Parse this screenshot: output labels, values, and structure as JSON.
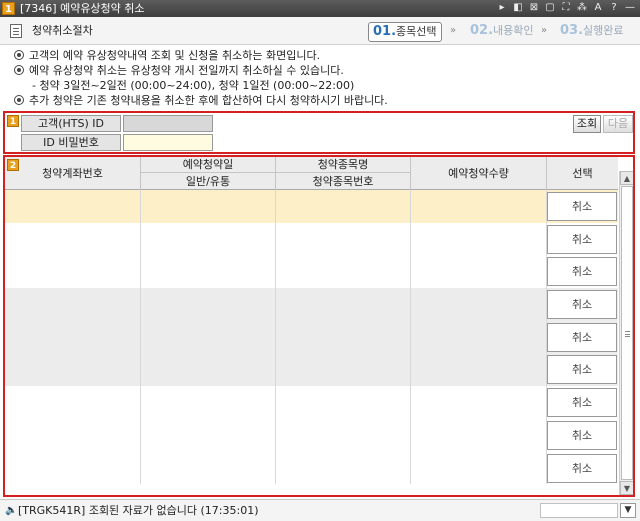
{
  "window": {
    "badge": "1",
    "title": "[7346] 예약유상청약 취소",
    "controls": [
      "▸",
      "◧",
      "⊠",
      "▢",
      "⛶",
      "⁂",
      "A",
      "?",
      "—"
    ]
  },
  "header": {
    "section_title": "청약취소절차",
    "steps": [
      {
        "num": "01.",
        "label": "종목선택"
      },
      {
        "num": "02.",
        "label": "내용확인"
      },
      {
        "num": "03.",
        "label": "실행완료"
      }
    ],
    "arrow": "»"
  },
  "notices": [
    "고객의 예약 유상청약내역 조회 및 신청을 취소하는 화면입니다.",
    "예약 유상청약 취소는 유상청약 개시 전일까지 취소하실 수 있습니다.",
    "- 청약 3일전~2일전 (00:00~24:00), 청약 1일전 (00:00~22:00)",
    "추가 청약은 기존 청약내용을 취소한 후에 합산하여 다시 청약하시기 바랍니다."
  ],
  "panel1": {
    "badge": "1",
    "id_label": "고객(HTS) ID",
    "id_value": "",
    "pw_label": "ID 비밀번호",
    "pw_value": "",
    "query_btn": "조회",
    "next_btn": "다음"
  },
  "panel2": {
    "badge": "2",
    "columns": {
      "account": "청약계좌번호",
      "date_top": "예약청약일",
      "date_bot": "일반/유통",
      "name_top": "청약종목명",
      "name_bot": "청약종목번호",
      "qty": "예약청약수량",
      "select": "선택"
    },
    "cancel_label": "취소",
    "rows": 9
  },
  "status": {
    "icon": "🔈",
    "text": "[TRGK541R] 조회된 자료가 없습니다 (17:35:01)",
    "dropdown": "▼"
  },
  "scrollbar": {
    "up": "▲",
    "down": "▼"
  }
}
